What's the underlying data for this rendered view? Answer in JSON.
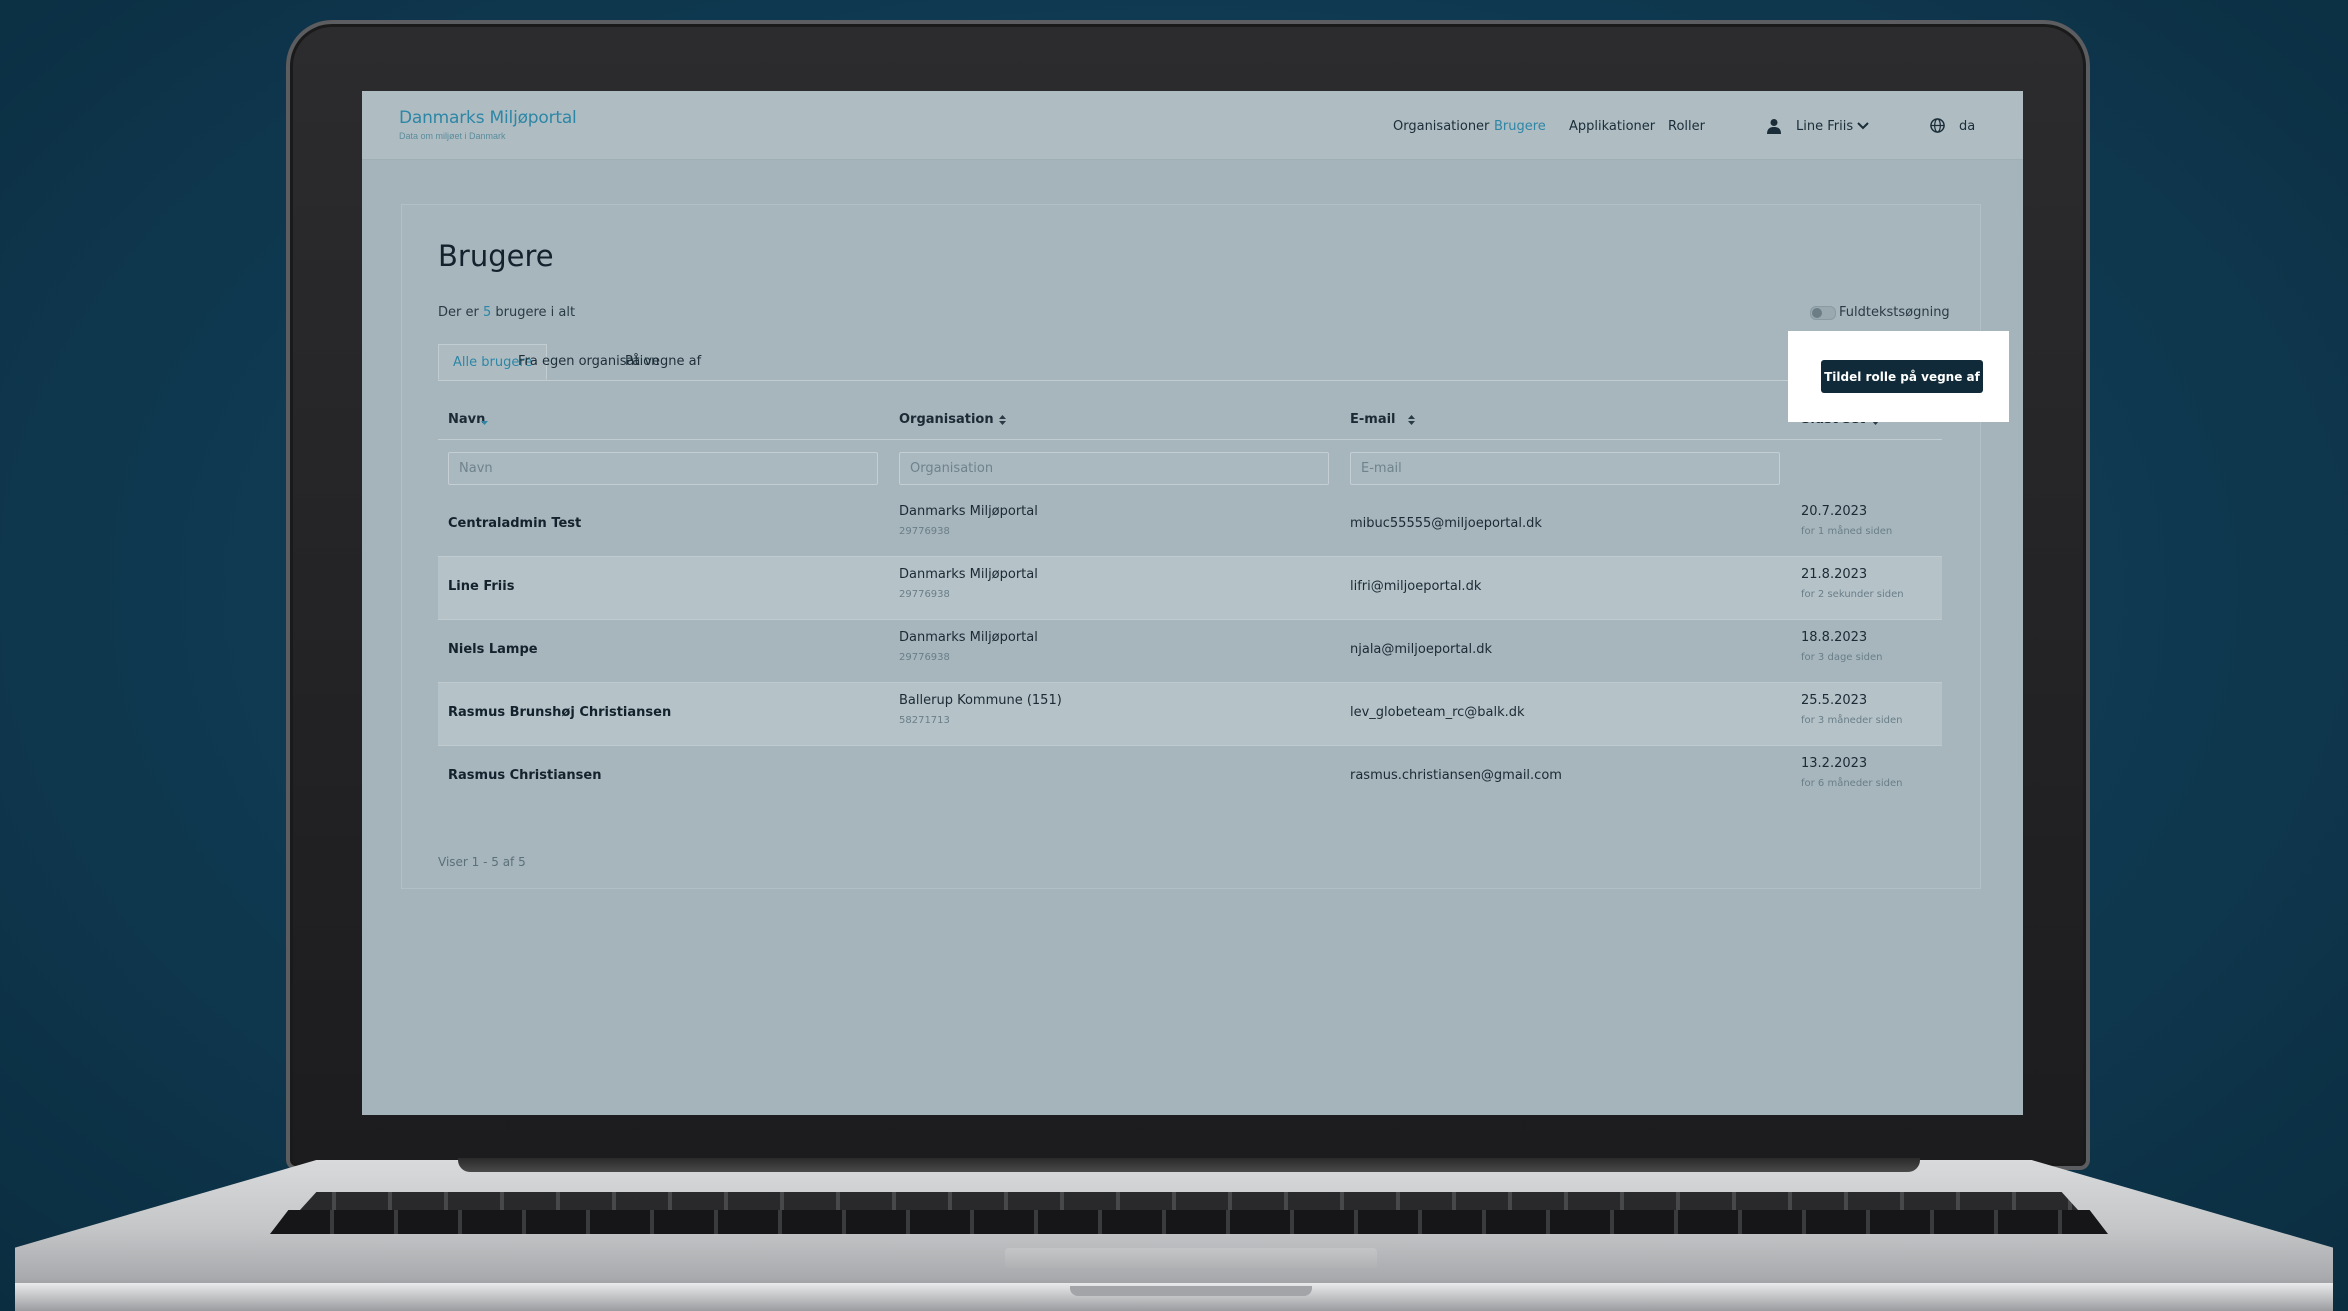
{
  "header": {
    "logo_title": "Danmarks Miljøportal",
    "logo_subtitle": "Data om miljøet i Danmark",
    "nav": [
      "Organisationer",
      "Brugere",
      "Applikationer",
      "Roller"
    ],
    "active_nav": "Brugere",
    "user_name": "Line Friis",
    "language": "da",
    "accent_color": "#2d86a6"
  },
  "page": {
    "title": "Brugere",
    "count_prefix": "Der er ",
    "count": "5",
    "count_suffix": " brugere i alt",
    "fulltext_label": "Fuldtekstsøgning",
    "fulltext_enabled": false,
    "cta_label": "Tildel rolle på vegne af",
    "cta_color": "#102a39"
  },
  "tabs": [
    "Alle brugere",
    "Fra egen organisation",
    "På vegne af"
  ],
  "active_tab": "Alle brugere",
  "table": {
    "columns": [
      "Navn",
      "Organisation",
      "E-mail",
      "Sidst set"
    ],
    "filters": {
      "name_placeholder": "Navn",
      "org_placeholder": "Organisation",
      "email_placeholder": "E-mail"
    },
    "rows": [
      {
        "name": "Centraladmin Test",
        "org": "Danmarks Miljøportal",
        "cvr": "29776938",
        "email": "mibuc55555@miljoeportal.dk",
        "date": "20.7.2023",
        "relative": "for 1 måned siden"
      },
      {
        "name": "Line Friis",
        "org": "Danmarks Miljøportal",
        "cvr": "29776938",
        "email": "lifri@miljoeportal.dk",
        "date": "21.8.2023",
        "relative": "for 2 sekunder siden"
      },
      {
        "name": "Niels Lampe",
        "org": "Danmarks Miljøportal",
        "cvr": "29776938",
        "email": "njala@miljoeportal.dk",
        "date": "18.8.2023",
        "relative": "for 3 dage siden"
      },
      {
        "name": "Rasmus Brunshøj Christiansen",
        "org": "Ballerup Kommune (151)",
        "cvr": "58271713",
        "email": "lev_globeteam_rc@balk.dk",
        "date": "25.5.2023",
        "relative": "for 3 måneder siden"
      },
      {
        "name": "Rasmus Christiansen",
        "org": "",
        "cvr": "",
        "email": "rasmus.christiansen@gmail.com",
        "date": "13.2.2023",
        "relative": "for 6 måneder siden"
      }
    ],
    "pager": "Viser 1 - 5 af 5"
  },
  "icons": {
    "user": "user-icon",
    "chevron": "chevron-down-icon",
    "globe": "globe-icon",
    "sort_active": "sort-desc-icon",
    "sort": "sort-icon"
  }
}
